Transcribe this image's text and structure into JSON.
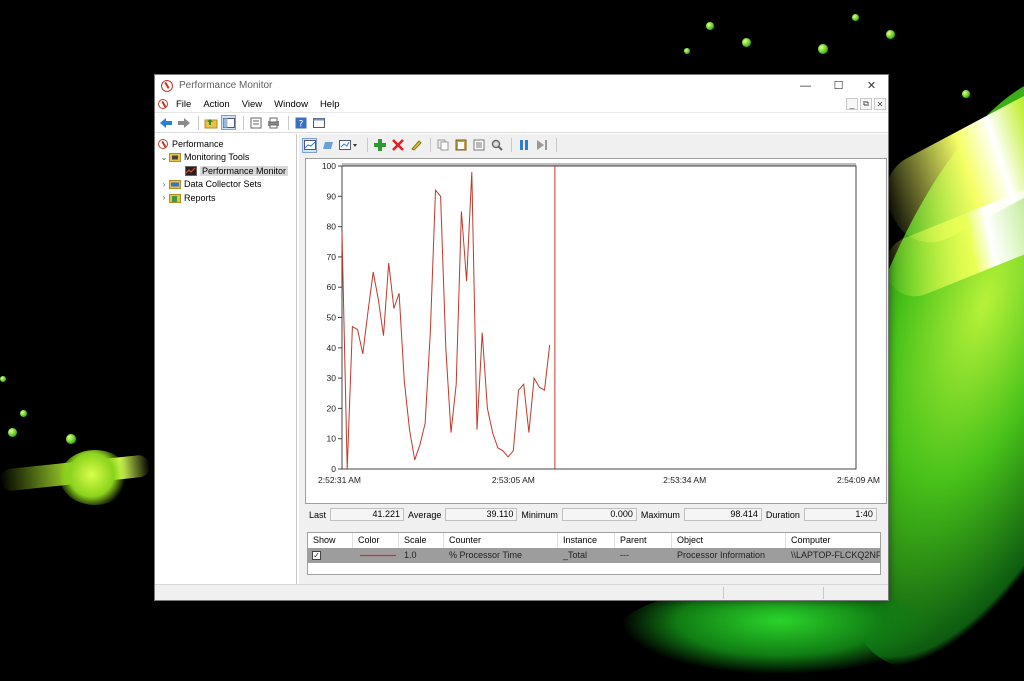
{
  "window": {
    "title": "Performance Monitor",
    "controls": {
      "minimize": "—",
      "maximize": "☐",
      "close": "✕"
    }
  },
  "menu": {
    "items": [
      "File",
      "Action",
      "View",
      "Window",
      "Help"
    ],
    "mdi": {
      "minimize": "_",
      "restore": "⧉",
      "close": "✕"
    }
  },
  "toolbar_icons": [
    "back-arrow-icon",
    "forward-arrow-icon",
    "up-folder-icon",
    "show-hide-tree-icon",
    "properties-icon",
    "print-icon",
    "help-icon",
    "console-icon"
  ],
  "tree": {
    "items": [
      {
        "label": "Performance",
        "level": 0,
        "icon": "performance-icon"
      },
      {
        "label": "Monitoring Tools",
        "level": 1,
        "icon": "folder-icon",
        "expanded": true
      },
      {
        "label": "Performance Monitor",
        "level": 2,
        "icon": "chart-icon",
        "selected": true
      },
      {
        "label": "Data Collector Sets",
        "level": 1,
        "icon": "folder-icon"
      },
      {
        "label": "Reports",
        "level": 1,
        "icon": "folder-icon"
      }
    ]
  },
  "graph_toolbar_icons": [
    "view-current-activity-icon",
    "view-log-data-icon",
    "change-graph-type-icon",
    "add-counter-icon",
    "delete-counter-icon",
    "highlight-icon",
    "copy-properties-icon",
    "paste-counter-list-icon",
    "properties-icon",
    "zoom-icon",
    "freeze-display-icon",
    "update-data-icon"
  ],
  "stats": {
    "last_label": "Last",
    "last_value": "41.221",
    "average_label": "Average",
    "average_value": "39.110",
    "minimum_label": "Minimum",
    "minimum_value": "0.000",
    "maximum_label": "Maximum",
    "maximum_value": "98.414",
    "duration_label": "Duration",
    "duration_value": "1:40"
  },
  "legend": {
    "headers": [
      "Show",
      "Color",
      "Scale",
      "Counter",
      "Instance",
      "Parent",
      "Object",
      "Computer"
    ],
    "rows": [
      {
        "show": "✓",
        "scale": "1.0",
        "counter": "% Processor Time",
        "instance": "_Total",
        "parent": "---",
        "object": "Processor Information",
        "computer": "\\\\LAPTOP-FLCKQ2NF"
      }
    ]
  },
  "colors": {
    "series": "#c0392b",
    "accent": "#c0392b"
  },
  "chart_data": {
    "type": "line",
    "title": "",
    "xlabel": "",
    "ylabel": "",
    "ylim": [
      0,
      100
    ],
    "yticks": [
      "0",
      "10",
      "20",
      "30",
      "40",
      "50",
      "60",
      "70",
      "80",
      "90",
      "100"
    ],
    "xticks": [
      "2:52:31 AM",
      "2:53:05 AM",
      "2:53:34 AM",
      "2:54:09 AM"
    ],
    "x_count": 100,
    "current_index": 41,
    "series": [
      {
        "values": [
          78,
          0,
          47,
          46,
          38,
          52,
          65,
          56,
          44,
          68,
          53,
          58,
          29,
          13,
          3,
          8,
          15,
          45,
          92,
          90,
          40,
          12,
          28,
          85,
          62,
          98,
          13,
          45,
          20,
          12,
          7,
          6,
          4,
          6,
          26,
          28,
          12,
          30,
          27,
          26,
          41
        ]
      }
    ]
  }
}
